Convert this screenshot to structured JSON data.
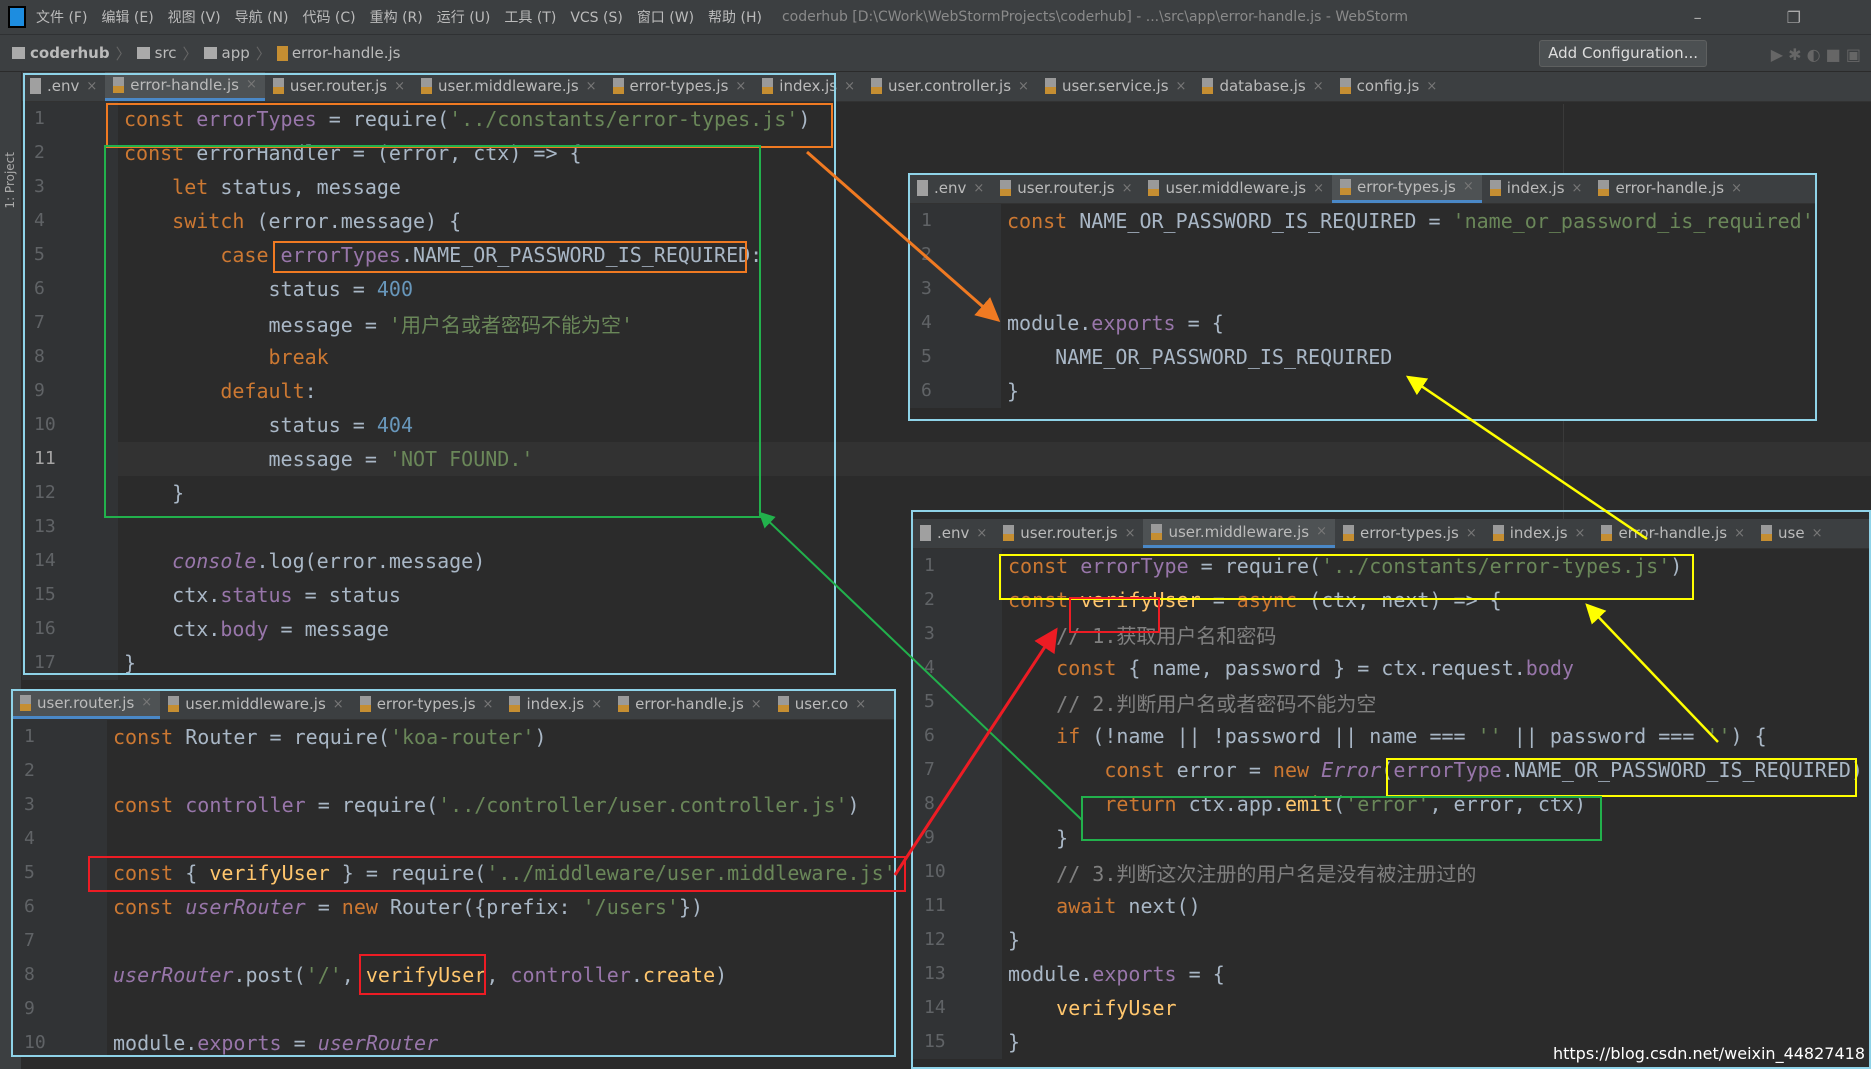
{
  "window": {
    "title": "coderhub [D:\\CWork\\WebStormProjects\\coderhub] - ...\\src\\app\\error-handle.js - WebStorm",
    "menu": [
      "文件 (F)",
      "编辑 (E)",
      "视图 (V)",
      "导航 (N)",
      "代码 (C)",
      "重构 (R)",
      "运行 (U)",
      "工具 (T)",
      "VCS (S)",
      "窗口 (W)",
      "帮助 (H)"
    ],
    "window_buttons": "–  ❐"
  },
  "breadcrumb": [
    "coderhub",
    "src",
    "app",
    "error-handle.js"
  ],
  "toolbar": {
    "add_configuration": "Add Configuration...",
    "run_icons": "▶ ✱ ◐ ■ ▣"
  },
  "sidebar": {
    "project_label": "1: Project"
  },
  "colors": {
    "keyword": "#cc7832",
    "string": "#6a8759",
    "field": "#9876aa",
    "number": "#6897bb",
    "comment": "#808080",
    "function": "#ffc66d",
    "annotation_orange": "#f07a22",
    "annotation_green": "#22b14c",
    "annotation_yellow": "#ffff00",
    "annotation_red": "#ed1c24",
    "panel_border": "#8fd3e8"
  },
  "panels": [
    {
      "id": "p-main",
      "gutter": 96,
      "current": 11,
      "tabs": [
        {
          "label": ".env",
          "js": false
        },
        {
          "label": "error-handle.js",
          "active": true
        },
        {
          "label": "user.router.js"
        },
        {
          "label": "user.middleware.js"
        },
        {
          "label": "error-types.js"
        },
        {
          "label": "index.js"
        },
        {
          "label": "user.controller.js"
        },
        {
          "label": "user.service.js"
        },
        {
          "label": "database.js"
        },
        {
          "label": "config.js"
        }
      ],
      "lines": [
        [
          [
            "const ",
            "kw"
          ],
          [
            "errorTypes",
            "pv"
          ],
          [
            " = require(",
            ""
          ],
          [
            "'../constants/error-types.js'",
            "str"
          ],
          [
            ")",
            ""
          ]
        ],
        [
          [
            "const ",
            "kw"
          ],
          [
            "errorHandler = (error, ctx) => {",
            ""
          ]
        ],
        [
          [
            "    let ",
            "kw"
          ],
          [
            "status, message",
            ""
          ]
        ],
        [
          [
            "    switch ",
            "kw"
          ],
          [
            "(error.message) {",
            ""
          ]
        ],
        [
          [
            "        case ",
            "kw"
          ],
          [
            "errorTypes",
            "pv"
          ],
          [
            ".NAME_OR_PASSWORD_IS_REQUIRED:",
            ""
          ]
        ],
        [
          [
            "            status = ",
            ""
          ],
          [
            "400",
            "num"
          ]
        ],
        [
          [
            "            message = ",
            ""
          ],
          [
            "'用户名或者密码不能为空'",
            "str"
          ]
        ],
        [
          [
            "            break",
            "kw"
          ]
        ],
        [
          [
            "        default",
            "kw"
          ],
          [
            ":",
            ""
          ]
        ],
        [
          [
            "            status = ",
            ""
          ],
          [
            "404",
            "num"
          ]
        ],
        [
          [
            "            message = ",
            ""
          ],
          [
            "'NOT FOUND.'",
            "str"
          ]
        ],
        [
          [
            "    }",
            ""
          ]
        ],
        [],
        [
          [
            "    console",
            "it"
          ],
          [
            ".log(error.message)",
            ""
          ]
        ],
        [
          [
            "    ctx.",
            ""
          ],
          [
            "status",
            "pv"
          ],
          [
            " = status",
            ""
          ]
        ],
        [
          [
            "    ctx.",
            ""
          ],
          [
            "body",
            "pv"
          ],
          [
            " = message",
            ""
          ]
        ],
        [
          [
            "}",
            ""
          ]
        ]
      ]
    },
    {
      "id": "p-tr",
      "gutter": 92,
      "tabs": [
        {
          "label": ".env",
          "js": false
        },
        {
          "label": "user.router.js"
        },
        {
          "label": "user.middleware.js"
        },
        {
          "label": "error-types.js",
          "active": true
        },
        {
          "label": "index.js"
        },
        {
          "label": "error-handle.js"
        }
      ],
      "lines": [
        [
          [
            "const ",
            "kw"
          ],
          [
            "NAME_OR_PASSWORD_IS_REQUIRED = ",
            ""
          ],
          [
            "'name_or_password_is_required'",
            "str"
          ]
        ],
        [],
        [],
        [
          [
            "module.",
            ""
          ],
          [
            "exports",
            "pv"
          ],
          [
            " = {",
            ""
          ]
        ],
        [
          [
            "    NAME_OR_PASSWORD_IS_REQUIRED",
            ""
          ]
        ],
        [
          [
            "}",
            ""
          ]
        ]
      ]
    },
    {
      "id": "p-br",
      "gutter": 90,
      "tabs": [
        {
          "label": ".env",
          "js": false
        },
        {
          "label": "user.router.js"
        },
        {
          "label": "user.middleware.js",
          "active": true
        },
        {
          "label": "error-types.js"
        },
        {
          "label": "index.js"
        },
        {
          "label": "error-handle.js"
        },
        {
          "label": "use"
        }
      ],
      "lines": [
        [
          [
            "const ",
            "kw"
          ],
          [
            "errorType",
            "pv"
          ],
          [
            " = require(",
            ""
          ],
          [
            "'../constants/error-types.js'",
            "str"
          ],
          [
            ")",
            ""
          ]
        ],
        [
          [
            "const ",
            "kw"
          ],
          [
            "verifyUser",
            "fn"
          ],
          [
            " = ",
            ""
          ],
          [
            "async ",
            "kw"
          ],
          [
            "(ctx, next) => {",
            ""
          ]
        ],
        [
          [
            "    // 1.获取用户名和密码",
            "cm"
          ]
        ],
        [
          [
            "    const ",
            "kw"
          ],
          [
            "{ name, password } = ctx.request.",
            ""
          ],
          [
            "body",
            "pv"
          ]
        ],
        [
          [
            "    // 2.判断用户名或者密码不能为空",
            "cm"
          ]
        ],
        [
          [
            "    if ",
            "kw"
          ],
          [
            "(!name || !password || name === ",
            ""
          ],
          [
            "''",
            "str"
          ],
          [
            " || password === ",
            ""
          ],
          [
            "''",
            "str"
          ],
          [
            ") {",
            ""
          ]
        ],
        [
          [
            "        const ",
            "kw"
          ],
          [
            "error = ",
            ""
          ],
          [
            "new ",
            "kw"
          ],
          [
            "Error",
            "it"
          ],
          [
            "(",
            ""
          ],
          [
            "errorType",
            "pv"
          ],
          [
            ".NAME_OR_PASSWORD_IS_REQUIRED)",
            ""
          ]
        ],
        [
          [
            "        return ",
            "kw"
          ],
          [
            "ctx.app.",
            ""
          ],
          [
            "emit",
            "fn"
          ],
          [
            "(",
            ""
          ],
          [
            "'error'",
            "str"
          ],
          [
            ", error, ctx)",
            ""
          ]
        ],
        [
          [
            "    }",
            ""
          ]
        ],
        [
          [
            "    // 3.判断这次注册的用户名是没有被注册过的",
            "cm"
          ]
        ],
        [
          [
            "    await ",
            "kw"
          ],
          [
            "next()",
            ""
          ]
        ],
        [
          [
            "}",
            ""
          ]
        ],
        [
          [
            "module.",
            ""
          ],
          [
            "exports",
            "pv"
          ],
          [
            " = {",
            ""
          ]
        ],
        [
          [
            "    verifyUser",
            "fn"
          ]
        ],
        [
          [
            "}",
            ""
          ]
        ]
      ]
    },
    {
      "id": "p-bl",
      "gutter": 95,
      "tabs": [
        {
          "label": "user.router.js",
          "active": true
        },
        {
          "label": "user.middleware.js"
        },
        {
          "label": "error-types.js"
        },
        {
          "label": "index.js"
        },
        {
          "label": "error-handle.js"
        },
        {
          "label": "user.co"
        }
      ],
      "lines": [
        [
          [
            "const ",
            "kw"
          ],
          [
            "Router = require(",
            ""
          ],
          [
            "'koa-router'",
            "str"
          ],
          [
            ")",
            ""
          ]
        ],
        [],
        [
          [
            "const ",
            "kw"
          ],
          [
            "controller",
            "pv"
          ],
          [
            " = require(",
            ""
          ],
          [
            "'../controller/user.controller.js'",
            "str"
          ],
          [
            ")",
            ""
          ]
        ],
        [],
        [
          [
            "const ",
            "kw"
          ],
          [
            "{ ",
            ""
          ],
          [
            "verifyUser",
            "fn"
          ],
          [
            " } = require(",
            ""
          ],
          [
            "'../middleware/user.middleware.js'",
            "str"
          ],
          [
            ")",
            ""
          ]
        ],
        [
          [
            "const ",
            "kw"
          ],
          [
            "userRouter",
            "it"
          ],
          [
            " = ",
            ""
          ],
          [
            "new ",
            "kw"
          ],
          [
            "Router({prefix: ",
            ""
          ],
          [
            "'/users'",
            "str"
          ],
          [
            "})",
            ""
          ]
        ],
        [],
        [
          [
            "userRouter",
            "it"
          ],
          [
            ".post(",
            ""
          ],
          [
            "'/'",
            "str"
          ],
          [
            ", ",
            ""
          ],
          [
            "verifyUser",
            "fn"
          ],
          [
            ", ",
            ""
          ],
          [
            "controller",
            "pv"
          ],
          [
            ".",
            ""
          ],
          [
            "create",
            "fn"
          ],
          [
            ")",
            ""
          ]
        ],
        [],
        [
          [
            "module.",
            ""
          ],
          [
            "exports",
            "pv"
          ],
          [
            " = ",
            ""
          ],
          [
            "userRouter",
            "it"
          ]
        ]
      ]
    }
  ],
  "watermark": "https://blog.csdn.net/weixin_44827418"
}
